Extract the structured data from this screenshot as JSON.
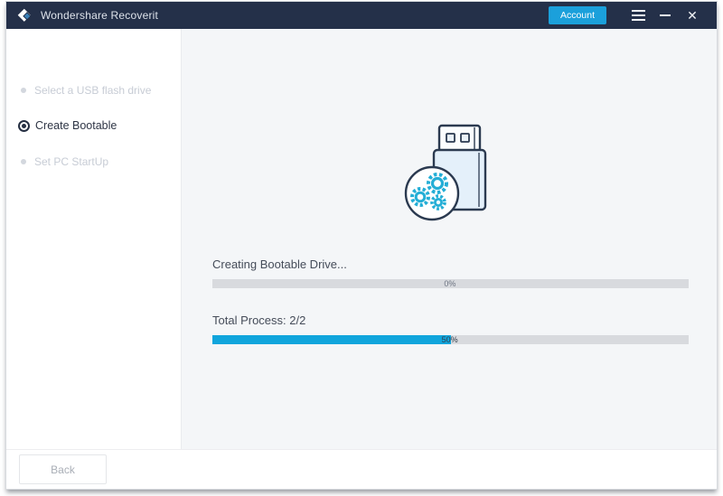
{
  "window": {
    "title": "Wondershare Recoverit"
  },
  "titlebar": {
    "account_label": "Account",
    "menu_icon": "hamburger-icon",
    "minimize_icon": "minimize-icon",
    "close_icon": "close-icon"
  },
  "sidebar": {
    "items": [
      {
        "label": "Select a USB flash drive",
        "state": "inactive"
      },
      {
        "label": "Create Bootable",
        "state": "active"
      },
      {
        "label": "Set PC StartUp",
        "state": "inactive"
      }
    ]
  },
  "main": {
    "illustration": "usb-drive-with-gears-icon",
    "current_task": {
      "label": "Creating Bootable Drive...",
      "percent_label": "0%",
      "value": 0
    },
    "total_process": {
      "label": "Total Process: 2/2",
      "percent_label": "50%",
      "value": 50
    }
  },
  "footer": {
    "back_label": "Back"
  },
  "colors": {
    "titlebar_bg": "#243049",
    "accent_blue": "#1ba0db",
    "progress_fill": "#10a5dc",
    "progress_track": "#d8dade",
    "main_bg": "#f4f6f8",
    "gear_teal": "#24aed6",
    "usb_fill": "#e4f0fa",
    "usb_outline": "#2b3a50"
  }
}
